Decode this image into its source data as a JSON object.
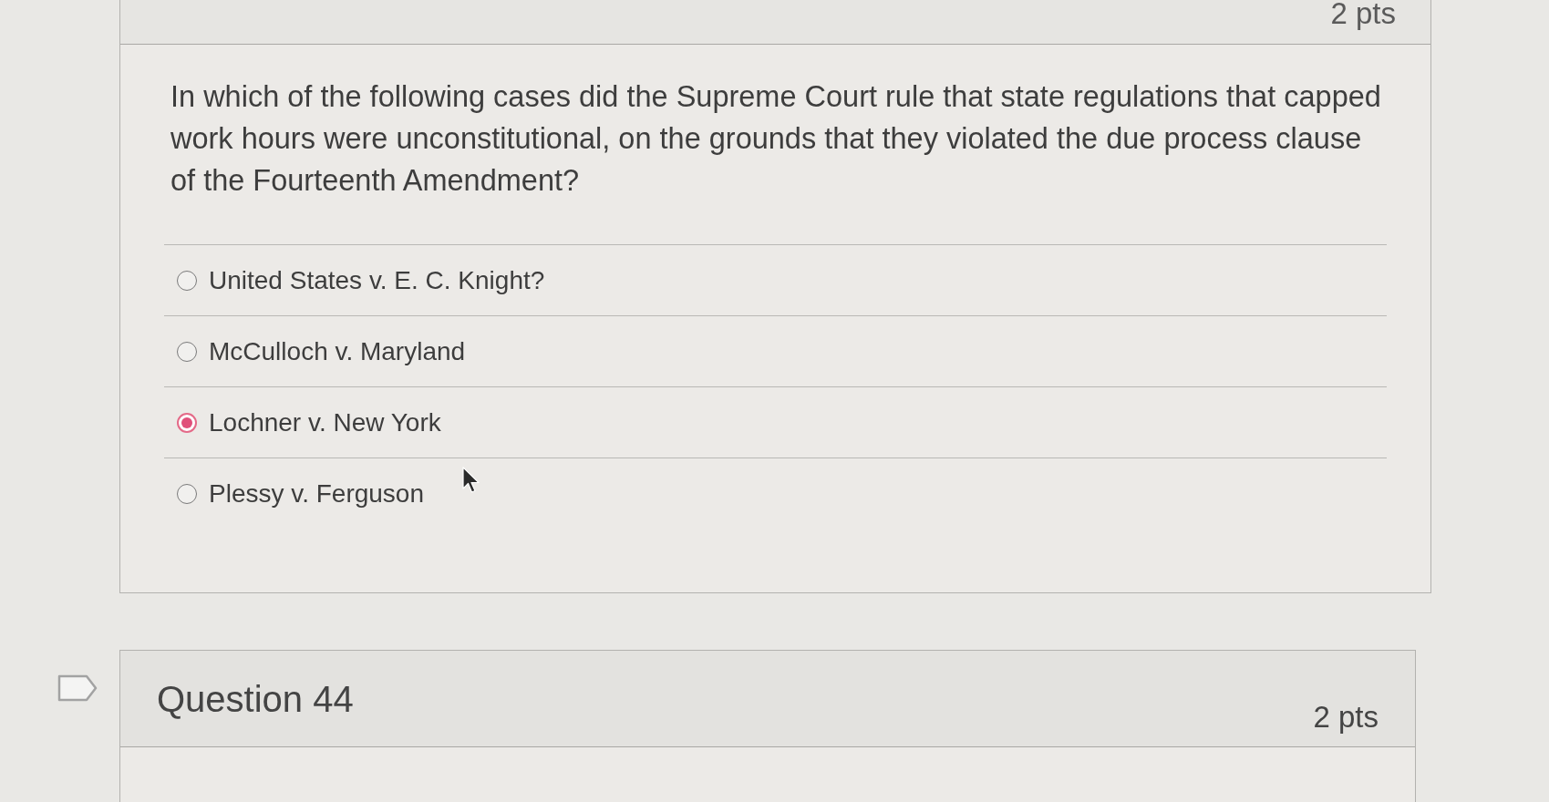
{
  "question_header": {
    "points": "2 pts"
  },
  "question": {
    "text": "In which of the following cases did the Supreme Court rule that state regulations that capped work hours were unconstitutional, on the grounds that they violated the due process clause of the Fourteenth Amendment?",
    "answers": [
      {
        "label": "United States v. E. C. Knight?",
        "selected": false
      },
      {
        "label": "McCulloch v. Maryland",
        "selected": false
      },
      {
        "label": "Lochner v. New York",
        "selected": true
      },
      {
        "label": "Plessy v. Ferguson",
        "selected": false
      }
    ]
  },
  "next_question": {
    "title": "Question 44",
    "points": "2 pts"
  }
}
